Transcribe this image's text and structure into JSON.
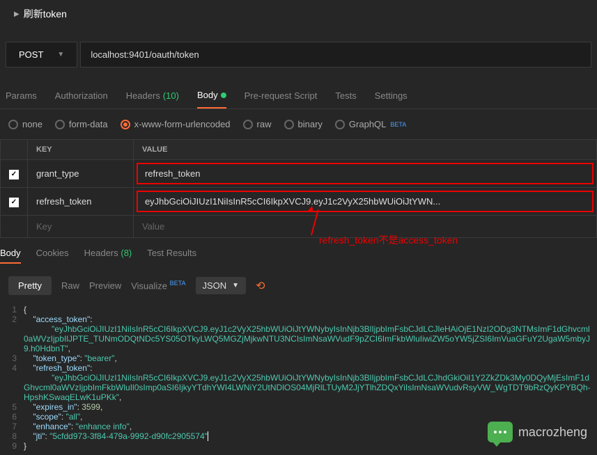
{
  "header": {
    "title": "刷新token"
  },
  "request": {
    "method": "POST",
    "url": "localhost:9401/oauth/token"
  },
  "tabs": {
    "params": "Params",
    "authorization": "Authorization",
    "headers": "Headers",
    "headers_count": "(10)",
    "body": "Body",
    "prerequest": "Pre-request Script",
    "tests": "Tests",
    "settings": "Settings"
  },
  "body_type": {
    "none": "none",
    "formdata": "form-data",
    "xwww": "x-www-form-urlencoded",
    "raw": "raw",
    "binary": "binary",
    "graphql": "GraphQL",
    "beta": "BETA"
  },
  "table": {
    "key_header": "KEY",
    "value_header": "VALUE",
    "rows": [
      {
        "key": "grant_type",
        "value": "refresh_token"
      },
      {
        "key": "refresh_token",
        "value": "eyJhbGciOiJIUzI1NiIsInR5cCI6IkpXVCJ9.eyJ1c2VyX25hbWUiOiJtYWN..."
      }
    ],
    "key_ph": "Key",
    "value_ph": "Value"
  },
  "annotation": "refresh_token不是access_token",
  "response_tabs": {
    "body": "Body",
    "cookies": "Cookies",
    "headers": "Headers",
    "headers_count": "(8)",
    "tests": "Test Results"
  },
  "view": {
    "pretty": "Pretty",
    "raw": "Raw",
    "preview": "Preview",
    "visualize": "Visualize",
    "beta": "BETA",
    "format": "JSON"
  },
  "json": {
    "l1": "{",
    "l2_key": "\"access_token\"",
    "l2_val": "\"eyJhbGciOiJIUzI1NiIsInR5cCI6IkpXVCJ9.eyJ1c2VyX25hbWUiOiJtYWNybyIsInNjb3BlIjpbImFsbCJdLCJleHAiOjE1NzI2ODg3NTMsImF1dGhvcml0aWVzIjpbIlJPTE_TUNmODQtNDc5YS05OTkyLWQ5MGZjMjkwNTU3NCIsImNsaWVudF9pZCI6ImFkbWluIiwiZW5oYW5jZSI6ImVuaGFuY2UgaW5mbyJ9.h0HdbnT\"",
    "l3_key": "\"token_type\"",
    "l3_val": "\"bearer\"",
    "l4_key": "\"refresh_token\"",
    "l4_val": "\"eyJhbGciOiJIUzI1NiIsInR5cCI6IkpXVCJ9.eyJ1c2VyX25hbWUiOiJtYWNybyIsInNjb3BlIjpbImFsbCJdLCJhdGkiOiI1Y2ZkZDk3My0DQyMjEsImF1dGhvcml0aWVzIjpbImFkbWluIl0sImp0aSI6IjkyYTdhYWI4LWNiY2UtNDlOS04MjRlLTUyM2JjYTlhZDQxYiIsImNsaWVudvRsyVW_WgTDT9bRzQyKPYBQh-HpshKSwaqELwK1uPKk\"",
    "l5_key": "\"expires_in\"",
    "l5_val": "3599",
    "l6_key": "\"scope\"",
    "l6_val": "\"all\"",
    "l7_key": "\"enhance\"",
    "l7_val": "\"enhance info\"",
    "l8_key": "\"jti\"",
    "l8_val": "\"5cfdd973-3f84-479a-9992-d90fc2905574\"",
    "l9": "}"
  },
  "watermark": "macrozheng"
}
